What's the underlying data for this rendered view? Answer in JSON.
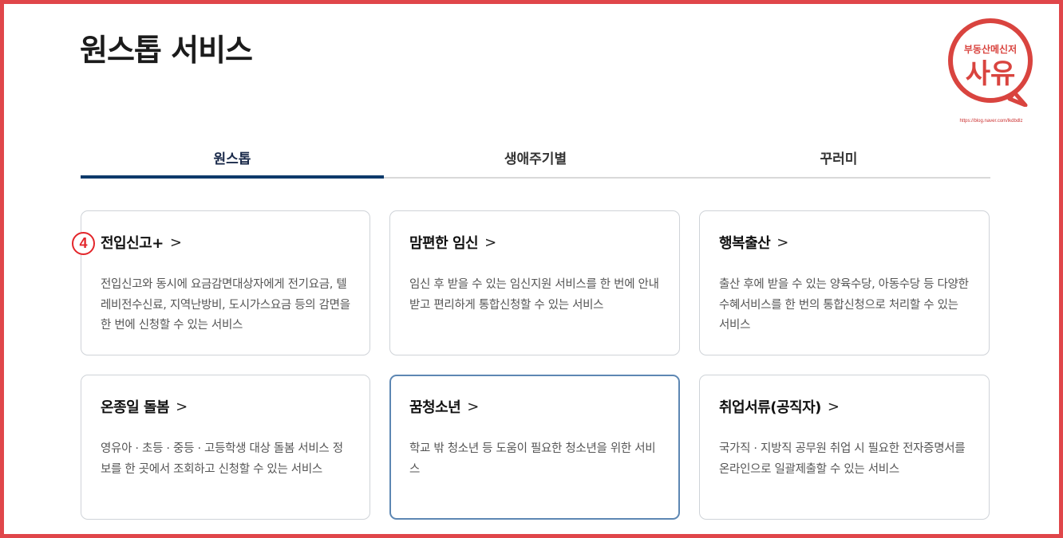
{
  "page": {
    "title": "원스톱 서비스"
  },
  "watermark": {
    "line1": "부동산메신저",
    "line2": "사유",
    "url": "https://blog.naver.com/lkdbdlz"
  },
  "tabs": [
    {
      "label": "원스톱",
      "active": true
    },
    {
      "label": "생애주기별",
      "active": false
    },
    {
      "label": "꾸러미",
      "active": false
    }
  ],
  "annotation": {
    "step_number": "4"
  },
  "cards": [
    {
      "title": "전입신고+",
      "arrow": ">",
      "desc": "전입신고와 동시에 요금감면대상자에게 전기요금, 텔레비전수신료, 지역난방비, 도시가스요금 등의 감면을 한 번에 신청할 수 있는 서비스"
    },
    {
      "title": "맘편한 임신",
      "arrow": ">",
      "desc": "임신 후 받을 수 있는 임신지원 서비스를 한 번에 안내받고 편리하게 통합신청할 수 있는 서비스"
    },
    {
      "title": "행복출산",
      "arrow": ">",
      "desc": "출산 후에 받을 수 있는 양육수당, 아동수당 등 다양한 수혜서비스를 한 번의 통합신청으로 처리할 수 있는 서비스"
    },
    {
      "title": "온종일 돌봄",
      "arrow": ">",
      "desc": "영유아 · 초등 · 중등 · 고등학생 대상 돌봄 서비스 정보를 한 곳에서 조회하고 신청할 수 있는 서비스"
    },
    {
      "title": "꿈청소년",
      "arrow": ">",
      "desc": "학교 밖 청소년 등 도움이 필요한 청소년을 위한 서비스"
    },
    {
      "title": "취업서류(공직자)",
      "arrow": ">",
      "desc": "국가직 · 지방직 공무원 취업 시 필요한 전자증명서를 온라인으로 일괄제출할 수 있는 서비스"
    }
  ]
}
